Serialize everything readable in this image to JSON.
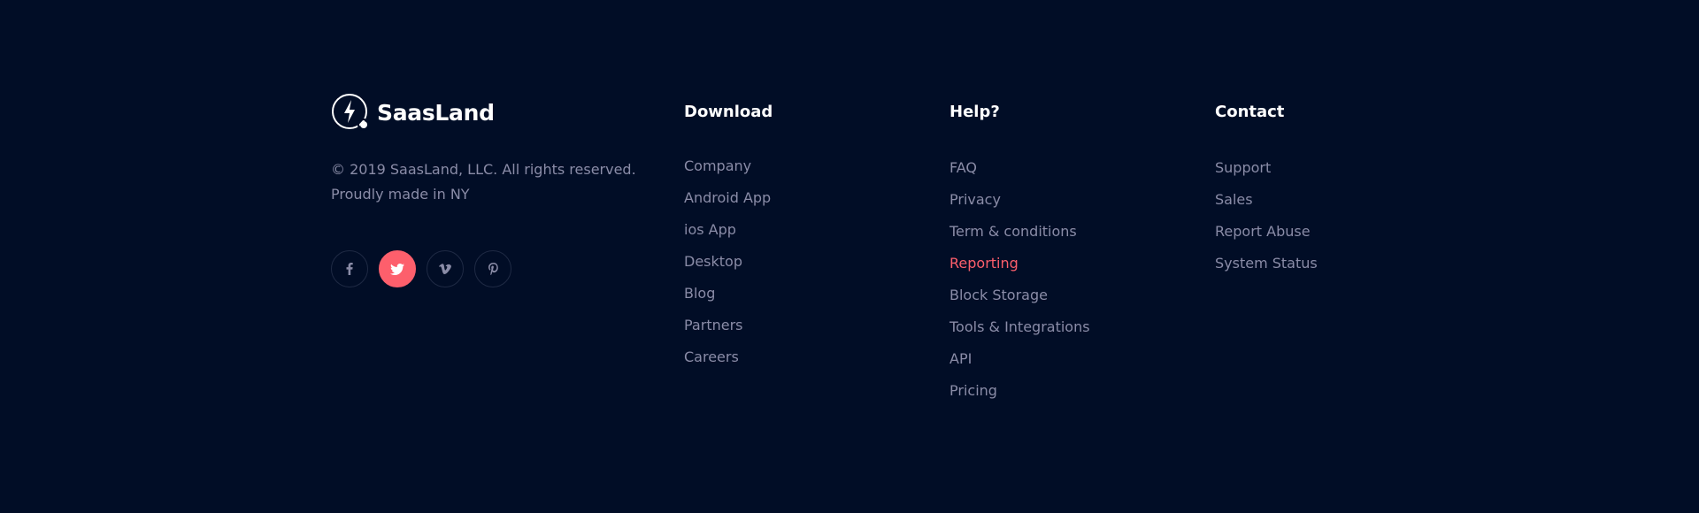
{
  "brand": {
    "name": "SaasLand",
    "logo_icon": "lightning-circle-icon"
  },
  "copyright": {
    "line1": "© 2019 SaasLand, LLC. All rights reserved.",
    "line2": "Proudly made in NY"
  },
  "social": [
    {
      "name": "facebook",
      "icon": "facebook-icon",
      "active": false
    },
    {
      "name": "twitter",
      "icon": "twitter-icon",
      "active": true
    },
    {
      "name": "vimeo",
      "icon": "vimeo-icon",
      "active": false
    },
    {
      "name": "pinterest",
      "icon": "pinterest-icon",
      "active": false
    }
  ],
  "columns": {
    "download": {
      "title": "Download",
      "links": [
        "Company",
        "Android App",
        "ios App",
        "Desktop",
        "Blog",
        "Partners",
        "Careers"
      ]
    },
    "help": {
      "title": "Help?",
      "links": [
        "FAQ",
        "Privacy",
        "Term & conditions",
        "Reporting",
        "Block Storage",
        "Tools & Integrations",
        "API",
        "Pricing"
      ],
      "highlighted": "Reporting"
    },
    "contact": {
      "title": "Contact",
      "links": [
        "Support",
        "Sales",
        "Report Abuse",
        "System Status"
      ]
    }
  },
  "colors": {
    "background": "#010d26",
    "text_muted": "#8a8ca7",
    "heading": "#ffffff",
    "accent": "#fd5f6c"
  }
}
